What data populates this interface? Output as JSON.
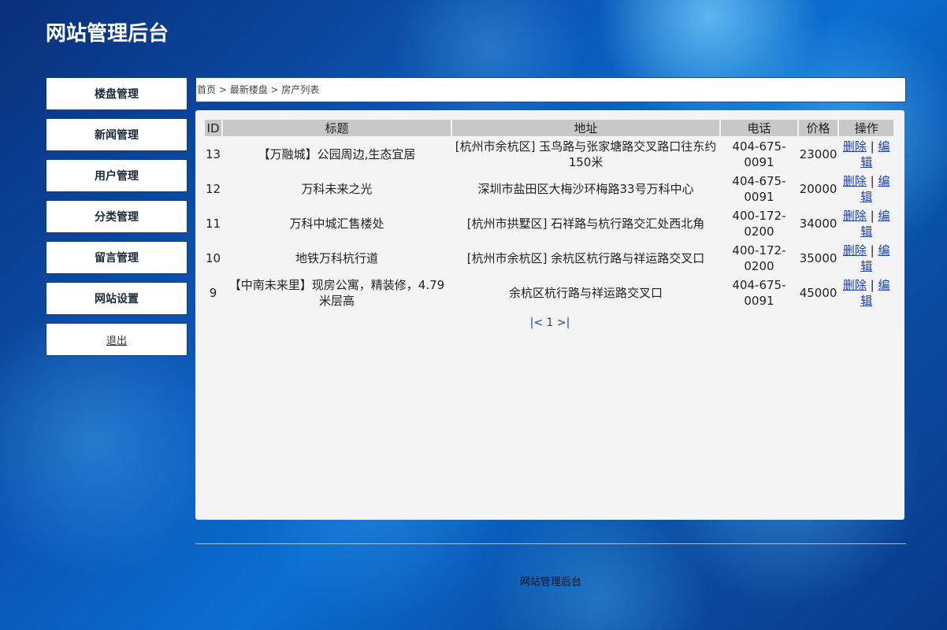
{
  "site": {
    "title": "网站管理后台"
  },
  "sidebar": {
    "items": [
      {
        "label": "楼盘管理"
      },
      {
        "label": "新闻管理"
      },
      {
        "label": "用户管理"
      },
      {
        "label": "分类管理"
      },
      {
        "label": "留言管理"
      },
      {
        "label": "网站设置"
      }
    ],
    "logout": "退出"
  },
  "breadcrumb": {
    "home": "首页",
    "sep": " > ",
    "section": "最新楼盘",
    "current": "房产列表"
  },
  "table": {
    "headers": {
      "id": "ID",
      "title": "标题",
      "address": "地址",
      "phone": "电话",
      "price": "价格",
      "ops": "操作"
    },
    "rows": [
      {
        "id": "13",
        "title": "【万融城】公园周边,生态宜居",
        "address": "[杭州市余杭区] 玉鸟路与张家塘路交叉路口往东约150米",
        "phone": "404-675-0091",
        "price": "23000",
        "delete": "删除",
        "sep": "|",
        "edit": "编辑"
      },
      {
        "id": "12",
        "title": "万科未来之光",
        "address": "深圳市盐田区大梅沙环梅路33号万科中心",
        "phone": "404-675-0091",
        "price": "20000",
        "delete": "删除",
        "sep": "|",
        "edit": "编辑"
      },
      {
        "id": "11",
        "title": "万科中城汇售楼处",
        "address": "[杭州市拱墅区] 石祥路与杭行路交汇处西北角",
        "phone": "400-172-0200",
        "price": "34000",
        "delete": "删除",
        "sep": "|",
        "edit": "编辑"
      },
      {
        "id": "10",
        "title": "地铁万科杭行道",
        "address": "[杭州市余杭区] 余杭区杭行路与祥运路交叉口",
        "phone": "400-172-0200",
        "price": "35000",
        "delete": "删除",
        "sep": "|",
        "edit": "编辑"
      },
      {
        "id": "9",
        "title": "【中南未来里】现房公寓，精装修，4.79米层高",
        "address": "余杭区杭行路与祥运路交叉口",
        "phone": "404-675-0091",
        "price": "45000",
        "delete": "删除",
        "sep": "|",
        "edit": "编辑"
      }
    ]
  },
  "pager": {
    "prev": "|<",
    "page": "1",
    "next": ">|"
  },
  "footer": {
    "text": "网站管理后台"
  }
}
